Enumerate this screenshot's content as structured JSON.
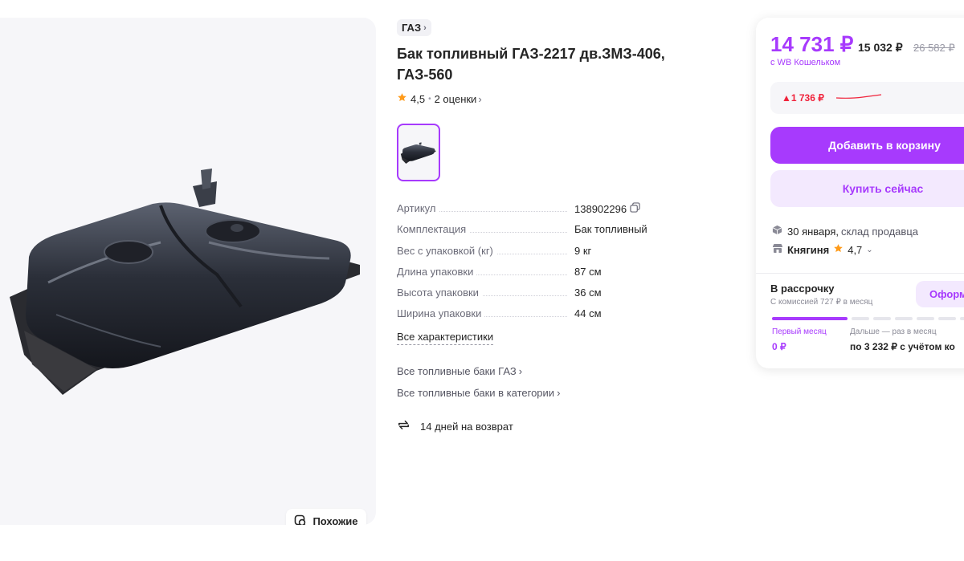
{
  "product": {
    "brand": "ГАЗ",
    "title": "Бак топливный ГАЗ-2217 дв.ЗМЗ-406, ГАЗ-560",
    "rating": "4,5",
    "reviews": "2 оценки",
    "similar_label": "Похожие"
  },
  "params": [
    {
      "name": "Артикул",
      "value": "138902296"
    },
    {
      "name": "Комплектация",
      "value": "Бак топливный"
    },
    {
      "name": "Вес с упаковкой (кг)",
      "value": "9 кг"
    },
    {
      "name": "Длина упаковки",
      "value": "87 см"
    },
    {
      "name": "Высота упаковки",
      "value": "36 см"
    },
    {
      "name": "Ширина упаковки",
      "value": "44 см"
    }
  ],
  "links": {
    "all_specs": "Все характеристики",
    "all_brand_tanks": "Все топливные баки ГАЗ",
    "all_category_tanks": "Все топливные баки в категории",
    "return_policy": "14 дней на возврат"
  },
  "buy": {
    "price_wallet": "14 731 ₽",
    "price": "15 032 ₽",
    "price_old": "26 582 ₽",
    "wallet_note": "с WB Кошельком",
    "price_delta": "▲1 736 ₽",
    "add_to_cart": "Добавить в корзину",
    "buy_now": "Купить сейчас",
    "delivery_date": "30 января,",
    "delivery_source": "склад продавца",
    "seller_name": "Княгиня",
    "seller_rating": "4,7"
  },
  "installment": {
    "title": "В рассрочку",
    "subtitle": "С комиссией 727 ₽ в месяц",
    "button": "Оформ",
    "first_label": "Первый месяц",
    "first_value": "0 ₽",
    "next_label": "Дальше — раз в месяц",
    "next_value": "по 3 232 ₽ с учётом ко"
  },
  "colors": {
    "accent": "#a73afd",
    "accent_light": "#f3e9fe",
    "price_up": "#f0233b",
    "star": "#ff9b1a"
  }
}
